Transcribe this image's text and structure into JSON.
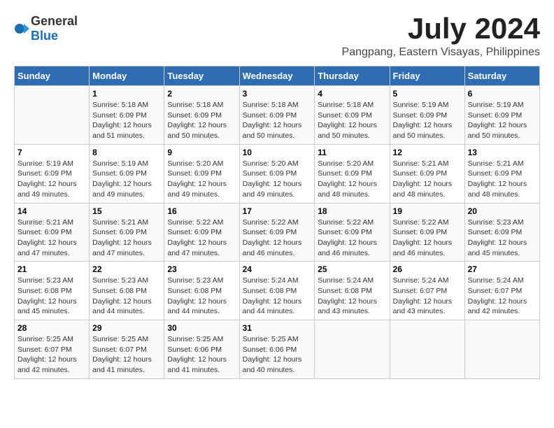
{
  "header": {
    "logo_general": "General",
    "logo_blue": "Blue",
    "title": "July 2024",
    "subtitle": "Pangpang, Eastern Visayas, Philippines"
  },
  "columns": [
    "Sunday",
    "Monday",
    "Tuesday",
    "Wednesday",
    "Thursday",
    "Friday",
    "Saturday"
  ],
  "weeks": [
    [
      {
        "day": "",
        "text": ""
      },
      {
        "day": "1",
        "text": "Sunrise: 5:18 AM\nSunset: 6:09 PM\nDaylight: 12 hours and 51 minutes."
      },
      {
        "day": "2",
        "text": "Sunrise: 5:18 AM\nSunset: 6:09 PM\nDaylight: 12 hours and 50 minutes."
      },
      {
        "day": "3",
        "text": "Sunrise: 5:18 AM\nSunset: 6:09 PM\nDaylight: 12 hours and 50 minutes."
      },
      {
        "day": "4",
        "text": "Sunrise: 5:18 AM\nSunset: 6:09 PM\nDaylight: 12 hours and 50 minutes."
      },
      {
        "day": "5",
        "text": "Sunrise: 5:19 AM\nSunset: 6:09 PM\nDaylight: 12 hours and 50 minutes."
      },
      {
        "day": "6",
        "text": "Sunrise: 5:19 AM\nSunset: 6:09 PM\nDaylight: 12 hours and 50 minutes."
      }
    ],
    [
      {
        "day": "7",
        "text": "Sunrise: 5:19 AM\nSunset: 6:09 PM\nDaylight: 12 hours and 49 minutes."
      },
      {
        "day": "8",
        "text": "Sunrise: 5:19 AM\nSunset: 6:09 PM\nDaylight: 12 hours and 49 minutes."
      },
      {
        "day": "9",
        "text": "Sunrise: 5:20 AM\nSunset: 6:09 PM\nDaylight: 12 hours and 49 minutes."
      },
      {
        "day": "10",
        "text": "Sunrise: 5:20 AM\nSunset: 6:09 PM\nDaylight: 12 hours and 49 minutes."
      },
      {
        "day": "11",
        "text": "Sunrise: 5:20 AM\nSunset: 6:09 PM\nDaylight: 12 hours and 48 minutes."
      },
      {
        "day": "12",
        "text": "Sunrise: 5:21 AM\nSunset: 6:09 PM\nDaylight: 12 hours and 48 minutes."
      },
      {
        "day": "13",
        "text": "Sunrise: 5:21 AM\nSunset: 6:09 PM\nDaylight: 12 hours and 48 minutes."
      }
    ],
    [
      {
        "day": "14",
        "text": "Sunrise: 5:21 AM\nSunset: 6:09 PM\nDaylight: 12 hours and 47 minutes."
      },
      {
        "day": "15",
        "text": "Sunrise: 5:21 AM\nSunset: 6:09 PM\nDaylight: 12 hours and 47 minutes."
      },
      {
        "day": "16",
        "text": "Sunrise: 5:22 AM\nSunset: 6:09 PM\nDaylight: 12 hours and 47 minutes."
      },
      {
        "day": "17",
        "text": "Sunrise: 5:22 AM\nSunset: 6:09 PM\nDaylight: 12 hours and 46 minutes."
      },
      {
        "day": "18",
        "text": "Sunrise: 5:22 AM\nSunset: 6:09 PM\nDaylight: 12 hours and 46 minutes."
      },
      {
        "day": "19",
        "text": "Sunrise: 5:22 AM\nSunset: 6:09 PM\nDaylight: 12 hours and 46 minutes."
      },
      {
        "day": "20",
        "text": "Sunrise: 5:23 AM\nSunset: 6:09 PM\nDaylight: 12 hours and 45 minutes."
      }
    ],
    [
      {
        "day": "21",
        "text": "Sunrise: 5:23 AM\nSunset: 6:08 PM\nDaylight: 12 hours and 45 minutes."
      },
      {
        "day": "22",
        "text": "Sunrise: 5:23 AM\nSunset: 6:08 PM\nDaylight: 12 hours and 44 minutes."
      },
      {
        "day": "23",
        "text": "Sunrise: 5:23 AM\nSunset: 6:08 PM\nDaylight: 12 hours and 44 minutes."
      },
      {
        "day": "24",
        "text": "Sunrise: 5:24 AM\nSunset: 6:08 PM\nDaylight: 12 hours and 44 minutes."
      },
      {
        "day": "25",
        "text": "Sunrise: 5:24 AM\nSunset: 6:08 PM\nDaylight: 12 hours and 43 minutes."
      },
      {
        "day": "26",
        "text": "Sunrise: 5:24 AM\nSunset: 6:07 PM\nDaylight: 12 hours and 43 minutes."
      },
      {
        "day": "27",
        "text": "Sunrise: 5:24 AM\nSunset: 6:07 PM\nDaylight: 12 hours and 42 minutes."
      }
    ],
    [
      {
        "day": "28",
        "text": "Sunrise: 5:25 AM\nSunset: 6:07 PM\nDaylight: 12 hours and 42 minutes."
      },
      {
        "day": "29",
        "text": "Sunrise: 5:25 AM\nSunset: 6:07 PM\nDaylight: 12 hours and 41 minutes."
      },
      {
        "day": "30",
        "text": "Sunrise: 5:25 AM\nSunset: 6:06 PM\nDaylight: 12 hours and 41 minutes."
      },
      {
        "day": "31",
        "text": "Sunrise: 5:25 AM\nSunset: 6:06 PM\nDaylight: 12 hours and 40 minutes."
      },
      {
        "day": "",
        "text": ""
      },
      {
        "day": "",
        "text": ""
      },
      {
        "day": "",
        "text": ""
      }
    ]
  ]
}
